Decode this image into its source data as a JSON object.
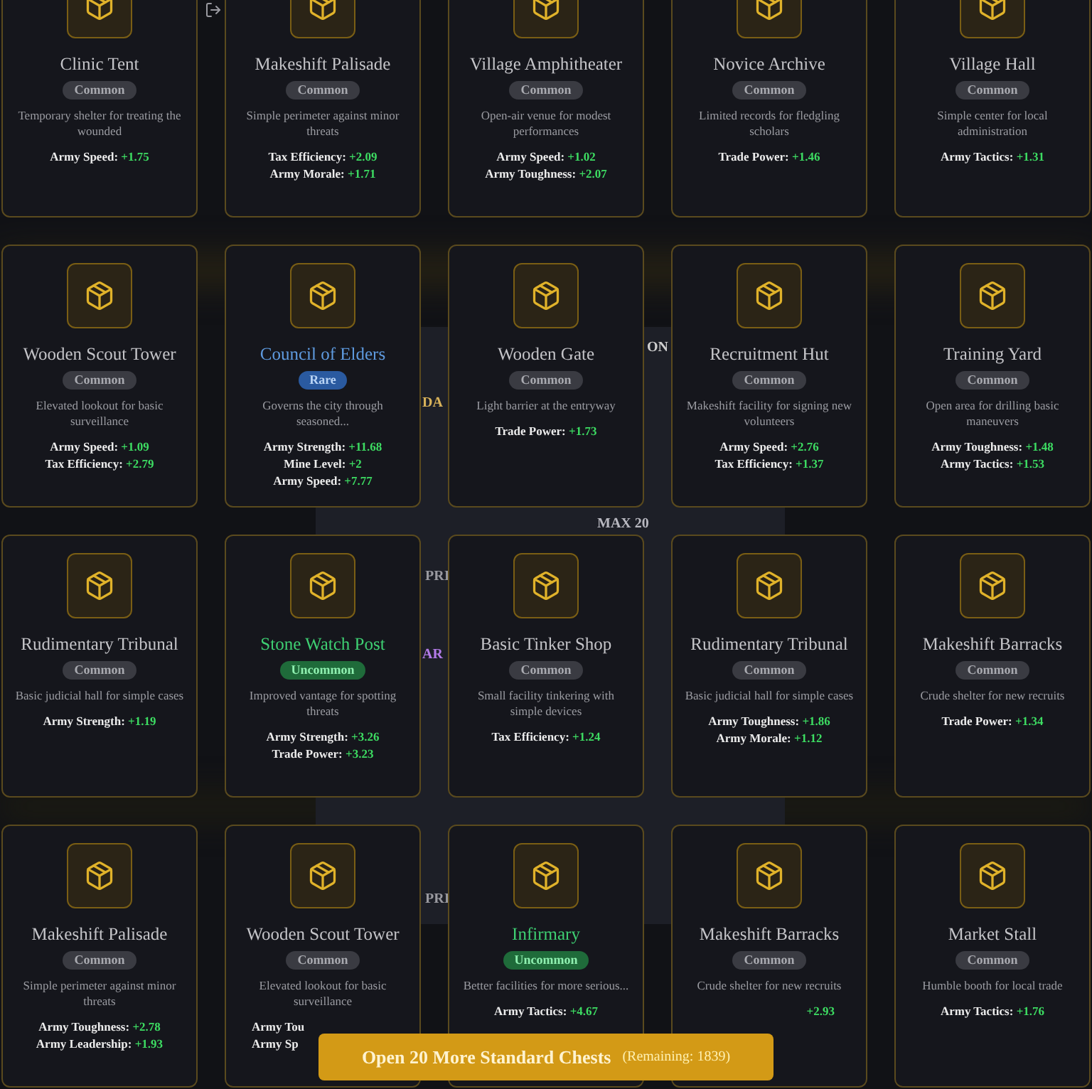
{
  "background_texts": [
    "ON",
    "DA",
    "MAX 20",
    "PRI",
    "AR",
    "PRI"
  ],
  "cards": [
    {
      "name": "Clinic Tent",
      "kind": "common",
      "badge": "Common",
      "description": "Temporary shelter for treating the wounded",
      "stats": [
        {
          "label": "Army Speed:",
          "value": "+1.75"
        }
      ]
    },
    {
      "name": "Makeshift Palisade",
      "kind": "common",
      "badge": "Common",
      "description": "Simple perimeter against minor threats",
      "stats": [
        {
          "label": "Tax Efficiency:",
          "value": "+2.09"
        },
        {
          "label": "Army Morale:",
          "value": "+1.71"
        }
      ]
    },
    {
      "name": "Village Amphitheater",
      "kind": "common",
      "badge": "Common",
      "description": "Open-air venue for modest performances",
      "stats": [
        {
          "label": "Army Speed:",
          "value": "+1.02"
        },
        {
          "label": "Army Toughness:",
          "value": "+2.07"
        }
      ]
    },
    {
      "name": "Novice Archive",
      "kind": "common",
      "badge": "Common",
      "description": "Limited records for fledgling scholars",
      "stats": [
        {
          "label": "Trade Power:",
          "value": "+1.46"
        }
      ]
    },
    {
      "name": "Village Hall",
      "kind": "common",
      "badge": "Common",
      "description": "Simple center for local administration",
      "stats": [
        {
          "label": "Army Tactics:",
          "value": "+1.31"
        }
      ]
    },
    {
      "name": "Wooden Scout Tower",
      "kind": "common",
      "badge": "Common",
      "description": "Elevated lookout for basic surveillance",
      "stats": [
        {
          "label": "Army Speed:",
          "value": "+1.09"
        },
        {
          "label": "Tax Efficiency:",
          "value": "+2.79"
        }
      ]
    },
    {
      "name": "Council of Elders",
      "kind": "rare",
      "badge": "Rare",
      "description": "Governs the city through seasoned...",
      "stats": [
        {
          "label": "Army Strength:",
          "value": "+11.68"
        },
        {
          "label": "Mine Level:",
          "value": "+2"
        },
        {
          "label": "Army Speed:",
          "value": "+7.77"
        }
      ]
    },
    {
      "name": "Wooden Gate",
      "kind": "common",
      "badge": "Common",
      "description": "Light barrier at the entryway",
      "stats": [
        {
          "label": "Trade Power:",
          "value": "+1.73"
        }
      ]
    },
    {
      "name": "Recruitment Hut",
      "kind": "common",
      "badge": "Common",
      "description": "Makeshift facility for signing new volunteers",
      "stats": [
        {
          "label": "Army Speed:",
          "value": "+2.76"
        },
        {
          "label": "Tax Efficiency:",
          "value": "+1.37"
        }
      ]
    },
    {
      "name": "Training Yard",
      "kind": "common",
      "badge": "Common",
      "description": "Open area for drilling basic maneuvers",
      "stats": [
        {
          "label": "Army Toughness:",
          "value": "+1.48"
        },
        {
          "label": "Army Tactics:",
          "value": "+1.53"
        }
      ]
    },
    {
      "name": "Rudimentary Tribunal",
      "kind": "common",
      "badge": "Common",
      "description": "Basic judicial hall for simple cases",
      "stats": [
        {
          "label": "Army Strength:",
          "value": "+1.19"
        }
      ]
    },
    {
      "name": "Stone Watch Post",
      "kind": "uncommon",
      "badge": "Uncommon",
      "description": "Improved vantage for spotting threats",
      "stats": [
        {
          "label": "Army Strength:",
          "value": "+3.26"
        },
        {
          "label": "Trade Power:",
          "value": "+3.23"
        }
      ]
    },
    {
      "name": "Basic Tinker Shop",
      "kind": "common",
      "badge": "Common",
      "description": "Small facility tinkering with simple devices",
      "stats": [
        {
          "label": "Tax Efficiency:",
          "value": "+1.24"
        }
      ]
    },
    {
      "name": "Rudimentary Tribunal",
      "kind": "common",
      "badge": "Common",
      "description": "Basic judicial hall for simple cases",
      "stats": [
        {
          "label": "Army Toughness:",
          "value": "+1.86"
        },
        {
          "label": "Army Morale:",
          "value": "+1.12"
        }
      ]
    },
    {
      "name": "Makeshift Barracks",
      "kind": "common",
      "badge": "Common",
      "description": "Crude shelter for new recruits",
      "stats": [
        {
          "label": "Trade Power:",
          "value": "+1.34"
        }
      ]
    },
    {
      "name": "Makeshift Palisade",
      "kind": "common",
      "badge": "Common",
      "description": "Simple perimeter against minor threats",
      "stats": [
        {
          "label": "Army Toughness:",
          "value": "+2.78"
        },
        {
          "label": "Army Leadership:",
          "value": "+1.93"
        }
      ]
    },
    {
      "name": "Wooden Scout Tower",
      "kind": "common",
      "badge": "Common",
      "description": "Elevated lookout for basic surveillance",
      "stats": [
        {
          "label": "Army Tou"
        },
        {
          "label": "Army Sp"
        }
      ]
    },
    {
      "name": "Infirmary",
      "kind": "uncommon",
      "badge": "Uncommon",
      "description": "Better facilities for more serious...",
      "stats": [
        {
          "label": "Army Tactics:",
          "value": "+4.67"
        }
      ]
    },
    {
      "name": "Makeshift Barracks",
      "kind": "common",
      "badge": "Common",
      "description": "Crude shelter for new recruits",
      "stats": [
        {
          "value": "+2.93"
        }
      ]
    },
    {
      "name": "Market Stall",
      "kind": "common",
      "badge": "Common",
      "description": "Humble booth for local trade",
      "stats": [
        {
          "label": "Army Tactics:",
          "value": "+1.76"
        }
      ]
    }
  ],
  "open_button": {
    "label": "Open 20 More Standard Chests",
    "remaining": "(Remaining: 1839)"
  }
}
